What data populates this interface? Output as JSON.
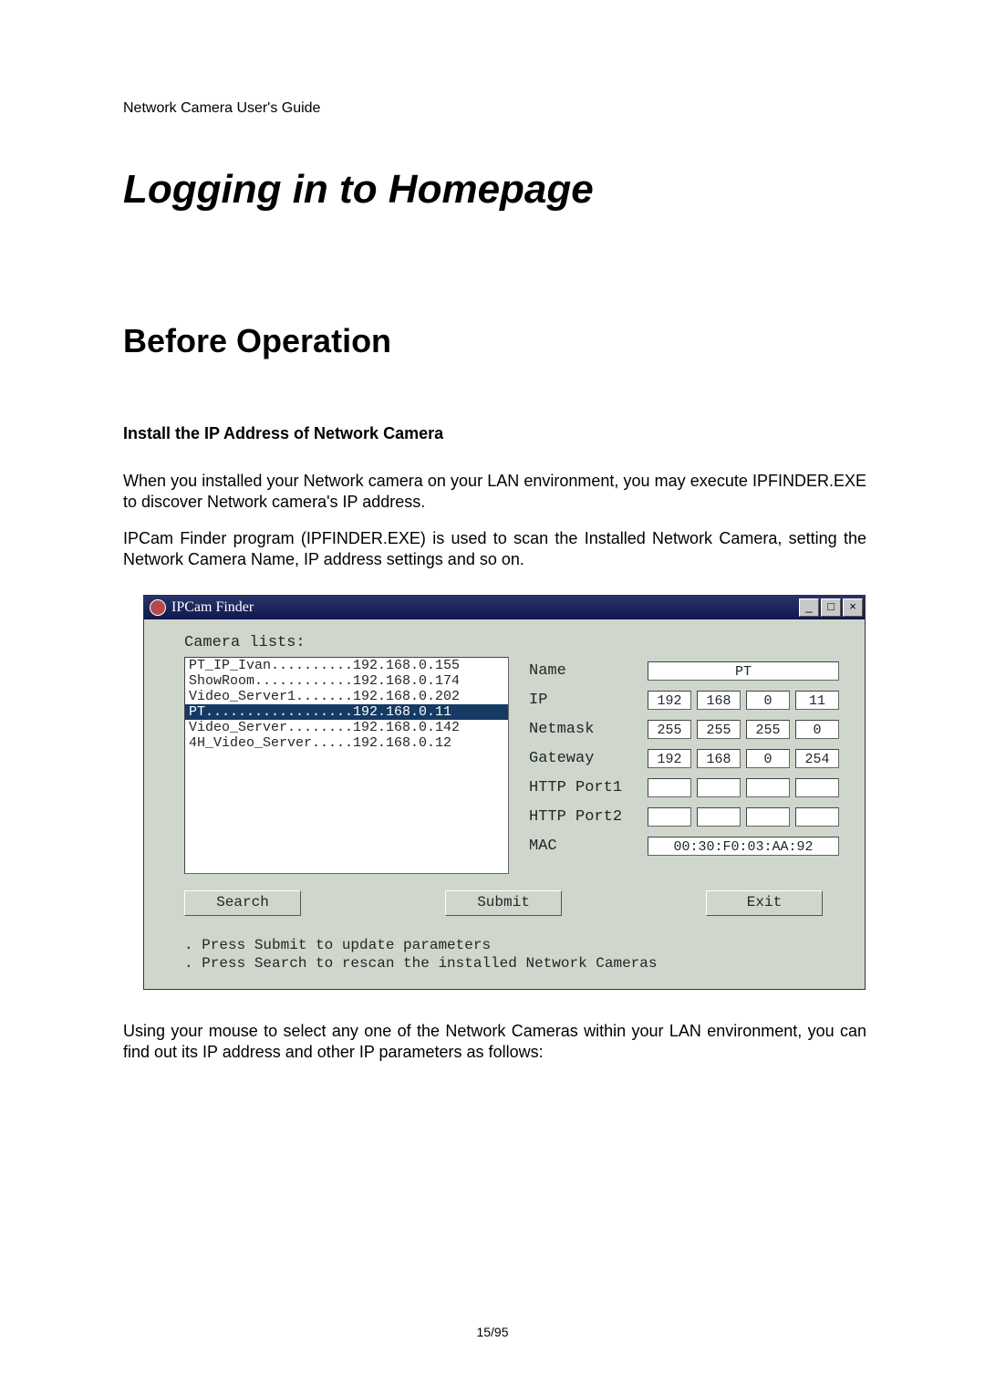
{
  "header": {
    "running": "Network Camera User's Guide"
  },
  "title": "Logging in to Homepage",
  "section": "Before Operation",
  "subhead": "Install the IP Address of Network Camera",
  "p1": "When you installed your Network camera on your LAN environment, you may execute IPFINDER.EXE to discover Network camera's IP address.",
  "p2": "IPCam Finder program (IPFINDER.EXE) is used to scan the Installed Network Camera, setting the Network Camera Name, IP address settings and so on.",
  "p3": "Using your mouse to select any one of the Network Cameras within your LAN environment, you can find out its IP address and other IP parameters as follows:",
  "footer": {
    "page": "15/95"
  },
  "finder": {
    "title": "IPCam Finder",
    "list_label": "Camera lists:",
    "rows": [
      "PT_IP_Ivan..........192.168.0.155",
      "ShowRoom............192.168.0.174",
      "Video_Server1.......192.168.0.202",
      "PT..................192.168.0.11",
      "Video_Server........192.168.0.142",
      "4H_Video_Server.....192.168.0.12"
    ],
    "selected_index": 3,
    "labels": {
      "name": "Name",
      "ip": "IP",
      "netmask": "Netmask",
      "gateway": "Gateway",
      "http1": "HTTP Port1",
      "http2": "HTTP Port2",
      "mac": "MAC"
    },
    "fields": {
      "name": "PT",
      "ip": [
        "192",
        "168",
        "0",
        "11"
      ],
      "netmask": [
        "255",
        "255",
        "255",
        "0"
      ],
      "gateway": [
        "192",
        "168",
        "0",
        "254"
      ],
      "http1": [
        "",
        "",
        "",
        ""
      ],
      "http2": [
        "",
        "",
        "",
        ""
      ],
      "mac": "00:30:F0:03:AA:92"
    },
    "buttons": {
      "search": "Search",
      "submit": "Submit",
      "exit": "Exit"
    },
    "hint1": ". Press Submit to update parameters",
    "hint2": ". Press Search to rescan the installed Network Cameras",
    "winbtns": {
      "min": "_",
      "max": "□",
      "close": "×"
    }
  }
}
